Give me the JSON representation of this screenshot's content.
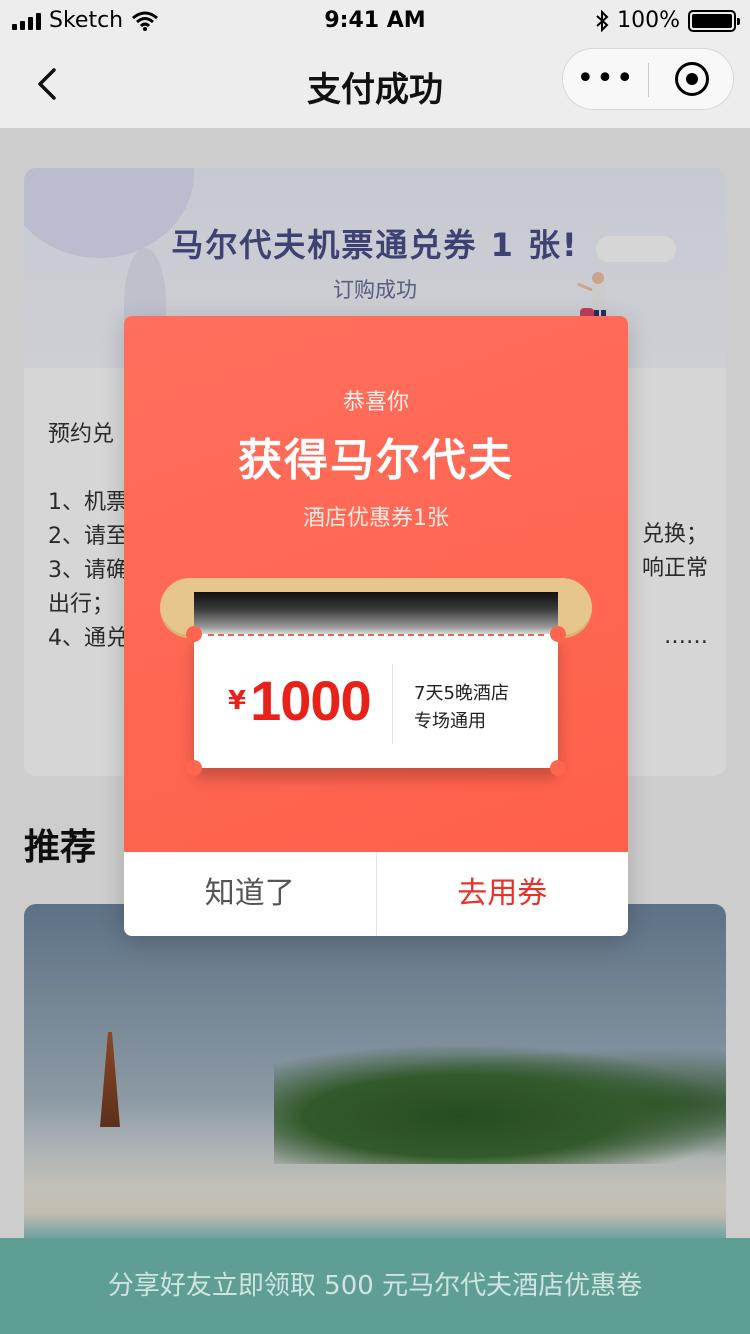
{
  "status_bar": {
    "carrier": "Sketch",
    "time": "9:41 AM",
    "battery": "100%"
  },
  "nav": {
    "title": "支付成功",
    "more_label": "•••"
  },
  "card": {
    "banner_title": "马尔代夫机票通兑券 1 张!",
    "banner_sub": "订购成功",
    "intro": "预约兑",
    "rules": [
      "1、机票",
      "2、请至",
      "3、请确",
      "出行；",
      "4、通兑"
    ],
    "rules_right": [
      "兑换；",
      "响正常",
      "……"
    ]
  },
  "section": {
    "title": "推荐"
  },
  "bottom_bar": {
    "text": "分享好友立即领取 500 元马尔代夫酒店优惠卷"
  },
  "modal": {
    "congrats": "恭喜你",
    "title": "获得马尔代夫",
    "subtitle": "酒店优惠券1张",
    "coupon": {
      "currency": "¥",
      "amount": "1000",
      "desc_line1": "7天5晚酒店",
      "desc_line2": "专场通用"
    },
    "btn_ok": "知道了",
    "btn_use": "去用券"
  },
  "colors": {
    "modal_bg": "#ff5e48",
    "accent_red": "#e8221b",
    "bottom_bar": "#5f9e95",
    "scroll_gold": "#e7c68d"
  },
  "icons": [
    "signal-icon",
    "wifi-icon",
    "bluetooth-icon",
    "battery-icon",
    "back-arrow-icon",
    "more-icon",
    "target-icon"
  ]
}
